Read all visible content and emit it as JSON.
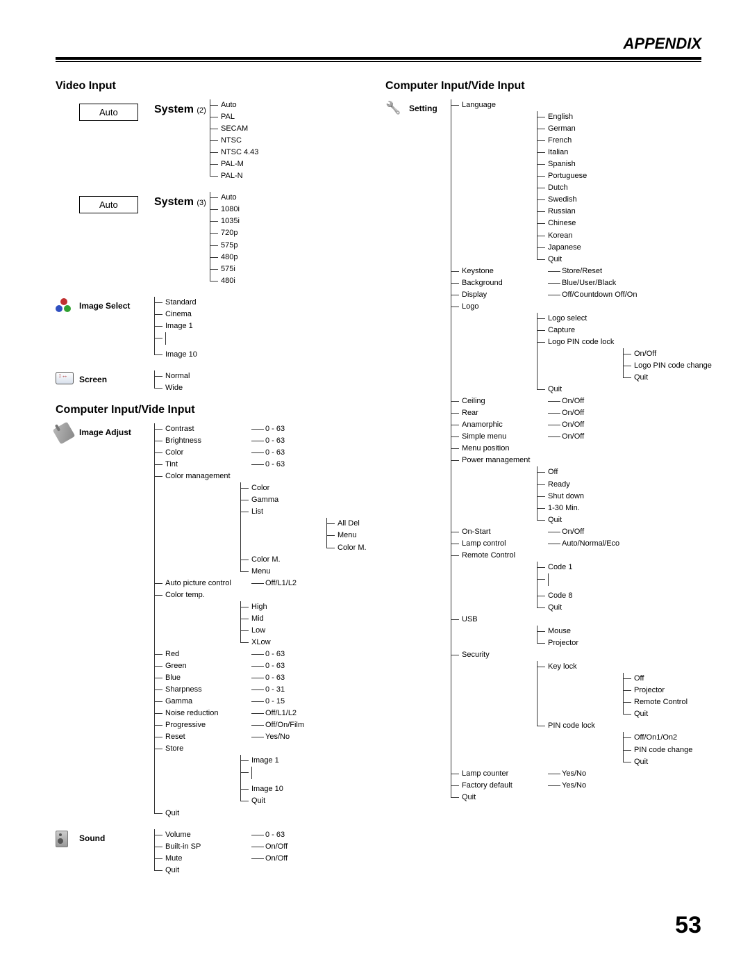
{
  "header": {
    "title": "APPENDIX"
  },
  "page_number": "53",
  "left": {
    "title_video": "Video Input",
    "title_ci": "Computer Input/Vide Input",
    "auto_label": "Auto",
    "groups": {
      "system2": {
        "label": "System",
        "note": "(2)",
        "items": [
          "Auto",
          "PAL",
          "SECAM",
          "NTSC",
          "NTSC 4.43",
          "PAL-M",
          "PAL-N"
        ]
      },
      "system3": {
        "label": "System",
        "note": "(3)",
        "items": [
          "Auto",
          "1080i",
          "1035i",
          "720p",
          "575p",
          "480p",
          "575i",
          "480i"
        ]
      },
      "image_select": {
        "label": "Image Select",
        "items": [
          "Standard",
          "Cinema",
          "Image 1",
          "…",
          "Image 10"
        ]
      },
      "screen": {
        "label": "Screen",
        "items": [
          "Normal",
          "Wide"
        ]
      },
      "image_adjust": {
        "label": "Image Adjust",
        "items": [
          {
            "name": "Contrast",
            "val": "0 - 63"
          },
          {
            "name": "Brightness",
            "val": "0 - 63"
          },
          {
            "name": "Color",
            "val": "0 - 63"
          },
          {
            "name": "Tint",
            "val": "0 - 63"
          },
          {
            "name": "Color management",
            "children": [
              {
                "name": "Color"
              },
              {
                "name": "Gamma"
              },
              {
                "name": "List",
                "children": [
                  {
                    "name": "All Del"
                  },
                  {
                    "name": "Menu"
                  },
                  {
                    "name": "Color M."
                  }
                ]
              },
              {
                "name": "Color M."
              },
              {
                "name": "Menu"
              }
            ]
          },
          {
            "name": "Auto picture control",
            "val": "Off/L1/L2"
          },
          {
            "name": "Color temp.",
            "children": [
              {
                "name": "High"
              },
              {
                "name": "Mid"
              },
              {
                "name": "Low"
              },
              {
                "name": "XLow"
              }
            ]
          },
          {
            "name": "Red",
            "val": "0 - 63"
          },
          {
            "name": "Green",
            "val": "0 - 63"
          },
          {
            "name": "Blue",
            "val": "0 - 63"
          },
          {
            "name": "Sharpness",
            "val": "0 - 31"
          },
          {
            "name": "Gamma",
            "val": "0 - 15"
          },
          {
            "name": "Noise reduction",
            "val": "Off/L1/L2"
          },
          {
            "name": "Progressive",
            "val": "Off/On/Film"
          },
          {
            "name": "Reset",
            "val": "Yes/No"
          },
          {
            "name": "Store",
            "children": [
              {
                "name": "Image 1"
              },
              {
                "name": "…"
              },
              {
                "name": "Image 10"
              },
              {
                "name": "Quit"
              }
            ]
          },
          {
            "name": "Quit"
          }
        ]
      },
      "sound": {
        "label": "Sound",
        "items": [
          {
            "name": "Volume",
            "val": "0 - 63"
          },
          {
            "name": "Built-in SP",
            "val": "On/Off"
          },
          {
            "name": "Mute",
            "val": "On/Off"
          },
          {
            "name": "Quit"
          }
        ]
      }
    }
  },
  "right": {
    "title": "Computer Input/Vide Input",
    "setting": {
      "label": "Setting",
      "items": [
        {
          "name": "Language",
          "children": [
            {
              "name": "English"
            },
            {
              "name": "German"
            },
            {
              "name": "French"
            },
            {
              "name": "Italian"
            },
            {
              "name": "Spanish"
            },
            {
              "name": "Portuguese"
            },
            {
              "name": "Dutch"
            },
            {
              "name": "Swedish"
            },
            {
              "name": "Russian"
            },
            {
              "name": "Chinese"
            },
            {
              "name": "Korean"
            },
            {
              "name": "Japanese"
            },
            {
              "name": "Quit"
            }
          ]
        },
        {
          "name": "Keystone",
          "val": "Store/Reset"
        },
        {
          "name": "Background",
          "val": "Blue/User/Black"
        },
        {
          "name": "Display",
          "val": "Off/Countdown Off/On"
        },
        {
          "name": "Logo",
          "children": [
            {
              "name": "Logo select"
            },
            {
              "name": "Capture"
            },
            {
              "name": "Logo PIN code lock",
              "children": [
                {
                  "name": "On/Off"
                },
                {
                  "name": "Logo PIN code change"
                },
                {
                  "name": "Quit"
                }
              ]
            },
            {
              "name": "Quit"
            }
          ]
        },
        {
          "name": "Ceiling",
          "val": "On/Off"
        },
        {
          "name": "Rear",
          "val": "On/Off"
        },
        {
          "name": "Anamorphic",
          "val": "On/Off"
        },
        {
          "name": "Simple menu",
          "val": "On/Off"
        },
        {
          "name": "Menu position"
        },
        {
          "name": "Power management",
          "children": [
            {
              "name": "Off"
            },
            {
              "name": "Ready"
            },
            {
              "name": "Shut down"
            },
            {
              "name": "1-30 Min."
            },
            {
              "name": "Quit"
            }
          ]
        },
        {
          "name": "On-Start",
          "val": "On/Off"
        },
        {
          "name": "Lamp control",
          "val": "Auto/Normal/Eco"
        },
        {
          "name": "Remote Control",
          "children": [
            {
              "name": "Code 1"
            },
            {
              "name": "…"
            },
            {
              "name": "Code 8"
            },
            {
              "name": "Quit"
            }
          ]
        },
        {
          "name": "USB",
          "children": [
            {
              "name": "Mouse"
            },
            {
              "name": "Projector"
            }
          ]
        },
        {
          "name": "Security",
          "children": [
            {
              "name": "Key lock",
              "children": [
                {
                  "name": "Off"
                },
                {
                  "name": "Projector"
                },
                {
                  "name": "Remote Control"
                },
                {
                  "name": "Quit"
                }
              ]
            },
            {
              "name": "PIN code lock",
              "children": [
                {
                  "name": "Off/On1/On2"
                },
                {
                  "name": "PIN code change"
                },
                {
                  "name": "Quit"
                }
              ]
            }
          ]
        },
        {
          "name": "Lamp counter",
          "val": "Yes/No"
        },
        {
          "name": "Factory default",
          "val": "Yes/No"
        },
        {
          "name": "Quit"
        }
      ]
    }
  }
}
